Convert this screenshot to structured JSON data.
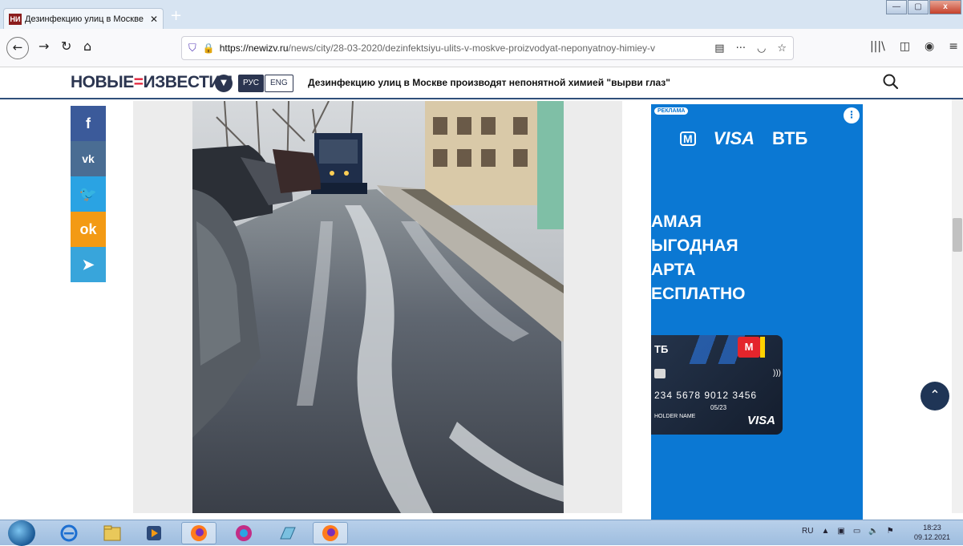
{
  "browser": {
    "tab_title": "Дезинфекцию улиц в Москве",
    "tab_close": "✕",
    "new_tab": "+",
    "url_domain": "https://newizv.ru",
    "url_path": "/news/city/28-03-2020/dezinfektsiyu-ulits-v-moskve-proizvodyat-neponyatnoy-himiey-v",
    "window_min": "—",
    "window_max": "▢",
    "window_close": "x"
  },
  "site": {
    "logo_left": "НОВЫЕ",
    "logo_mid": "=",
    "logo_right": "ИЗВЕСТИЯ",
    "lang_ru": "РУС",
    "lang_en": "ENG",
    "headline": "Дезинфекцию улиц в Москве производят непонятной химией \"вырви глаз\""
  },
  "social": {
    "facebook": "f",
    "vk": "vk",
    "twitter": "🐦",
    "odnoklassniki": "ok",
    "telegram": "➤"
  },
  "ad": {
    "label": "РЕКЛАМА",
    "menu": "⋮",
    "brand_m": "M",
    "brand_visa": "VISA",
    "brand_vtb": "ВТБ",
    "line1": "АМАЯ",
    "line2": "ЫГОДНАЯ",
    "line3": "АРТА",
    "line4": "ЕСПЛАТНО",
    "card_bank": "ТБ",
    "card_number": "234 5678 9012 3456",
    "card_expiry": "05/23",
    "card_holder": "HOLDER NAME",
    "card_visa": "VISA"
  },
  "taskbar": {
    "lang": "RU",
    "time": "18:23",
    "date": "09.12.2021"
  },
  "colors": {
    "brand_navy": "#2b3550",
    "brand_red": "#e3263c",
    "ad_blue": "#0b78d3"
  }
}
